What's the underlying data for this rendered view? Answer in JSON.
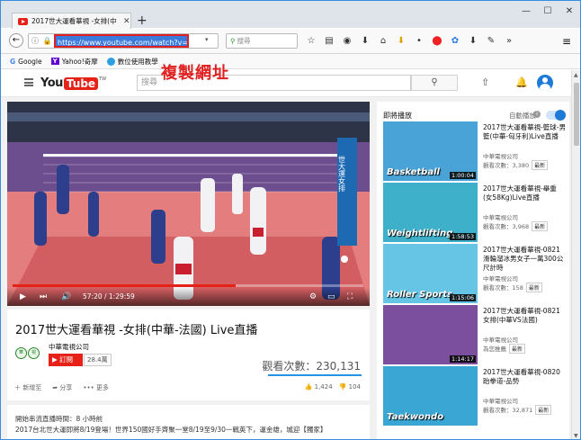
{
  "browser": {
    "tab_title": "2017世大運看華視 -女排(中",
    "url": "https://www.youtube.com/watch?v=",
    "search_placeholder": "搜尋",
    "bookmarks": [
      "Google",
      "Yahoo!奇摩",
      "數位使用教學"
    ]
  },
  "annotation": "複製網址",
  "youtube": {
    "logo_you": "You",
    "logo_tube": "Tube",
    "logo_region": "TW",
    "search_placeholder": "搜尋"
  },
  "player": {
    "time": "57:20 / 1:29:59",
    "progress_fraction": 0.637,
    "overlay_text": "世大運女排 中華 vs. 法國"
  },
  "video": {
    "title": "2017世大運看華視 -女排(中華-法國) Live直播",
    "channel": "中華電視公司",
    "subscribe_label": "訂閱",
    "subscriber_count": "28.4萬",
    "views": "觀看次數：230,131",
    "actions": [
      "新增至",
      "分享",
      "更多"
    ],
    "likes": "1,424",
    "dislikes": "104"
  },
  "description": {
    "line1": "開始串流直播時間：8 小時前",
    "line2": "2017台北世大運即將8/19登場！世界150國好手齊聚一堂8/19至9/30一戰英下，運金雄，城迎【獨家】"
  },
  "sidebar": {
    "up_next": "即將播放",
    "autoplay": "自動播放",
    "new_label": "最新",
    "items": [
      {
        "title": "2017世大運看華視-籃球-男籃(中華-匈牙利)Live直播",
        "channel": "中華電視公司",
        "views": "觀看次數：3,380",
        "duration": "1:00:04",
        "thumb_text": "Basketball",
        "thumb_color": "#4aa3d6"
      },
      {
        "title": "2017世大運看華視-舉重(女58Kg)Live直播",
        "channel": "中華電視公司",
        "views": "觀看次數：3,968",
        "duration": "1:58:53",
        "thumb_text": "Weightlifting",
        "thumb_color": "#3fb0c9"
      },
      {
        "title": "2017世大運看華視-0821滑輪溜冰男女子一萬300公尺計時",
        "channel": "中華電視公司",
        "views": "觀看次數：158",
        "duration": "1:15:06",
        "thumb_text": "Roller Sports",
        "thumb_color": "#66c4e4"
      },
      {
        "title": "2017世大運看華視-0821女排(中華VS法國)",
        "channel": "中華電視公司",
        "views": "為您推薦",
        "duration": "1:14:17",
        "thumb_text": "",
        "thumb_color": "#7b4e9e"
      },
      {
        "title": "2017世大運看華視-0820跆拳道-品勢",
        "channel": "中華電視公司",
        "views": "觀看次數：32,871",
        "duration": "",
        "thumb_text": "Taekwondo",
        "thumb_color": "#3aa6d4"
      }
    ]
  }
}
